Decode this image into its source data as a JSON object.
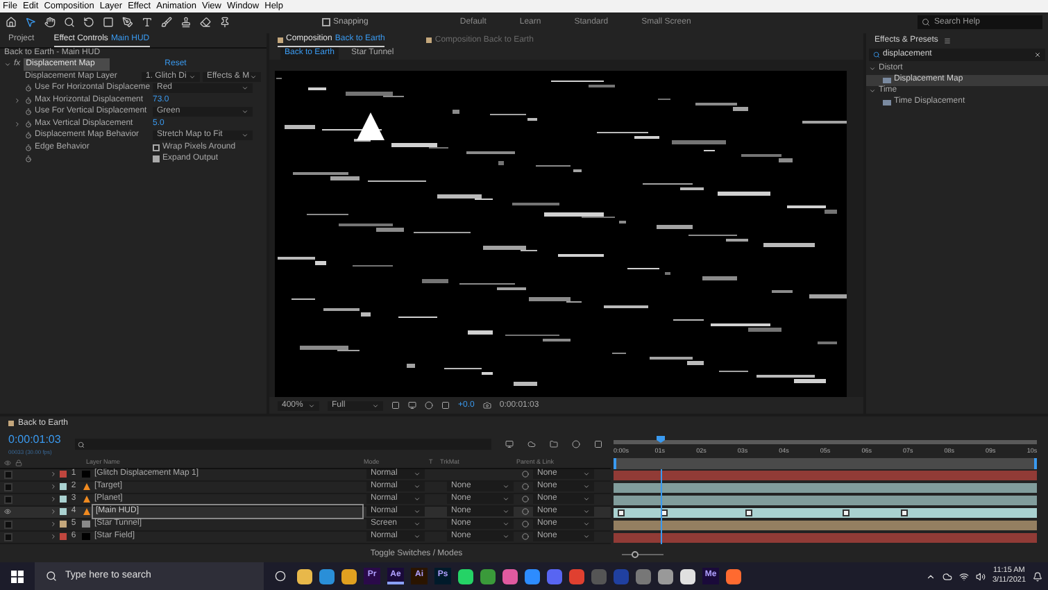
{
  "menu": [
    "File",
    "Edit",
    "Composition",
    "Layer",
    "Effect",
    "Animation",
    "View",
    "Window",
    "Help"
  ],
  "toolbar": {
    "snapping": {
      "label": "Snapping",
      "checked": false
    },
    "workspaces": [
      {
        "label": "Default",
        "selected": false
      },
      {
        "label": "Learn",
        "selected": false
      },
      {
        "label": "Standard",
        "selected": false
      },
      {
        "label": "Small Screen",
        "selected": false
      }
    ],
    "search": {
      "placeholder": "Search Help"
    }
  },
  "left_panel": {
    "tabs": [
      {
        "label": "Project",
        "selected": false
      },
      {
        "label": "Effect Controls",
        "target": "Main HUD",
        "selected": true
      }
    ],
    "breadcrumb": "Back to Earth - Main HUD",
    "effect": {
      "fx": "fx",
      "name": "Displacement Map",
      "reset": "Reset",
      "expanded": true
    },
    "rows": [
      {
        "kind": "popup2",
        "label": "Displacement Map Layer",
        "value": "1. Glitch Di",
        "value2": "Effects & M"
      },
      {
        "kind": "popup",
        "label": "Use For Horizontal Displaceme",
        "value": "Red"
      },
      {
        "kind": "number",
        "label": "Max Horizontal Displacement",
        "value": "73.0"
      },
      {
        "kind": "popup",
        "label": "Use For Vertical Displacement",
        "value": "Green"
      },
      {
        "kind": "number",
        "label": "Max Vertical Displacement",
        "value": "5.0"
      },
      {
        "kind": "popup",
        "label": "Displacement Map Behavior",
        "value": "Stretch Map to Fit"
      },
      {
        "kind": "check",
        "label": "Edge Behavior",
        "value": "Wrap Pixels Around",
        "checked": false
      },
      {
        "kind": "check",
        "value": "Expand Output",
        "checked": true
      }
    ]
  },
  "composition": {
    "tabs": [
      {
        "label": "Composition",
        "target": "Back to Earth",
        "selected": true
      },
      {
        "label": "Composition Back to Earth",
        "selected": false
      }
    ],
    "breadcrumbs": [
      {
        "label": "Back to Earth",
        "selected": true
      },
      {
        "label": "Star Tunnel",
        "selected": false
      }
    ],
    "zoom": "400%",
    "resolution": "Full",
    "exposure": "+0.0",
    "timecode": "0:00:01:03"
  },
  "effects_presets": {
    "title": "Effects & Presets",
    "search": "displacement",
    "tree": [
      {
        "label": "Distort",
        "expanded": true,
        "children": [
          {
            "label": "Displacement Map",
            "selected": true
          }
        ]
      },
      {
        "label": "Time",
        "expanded": true,
        "children": [
          {
            "label": "Time Displacement",
            "selected": false
          }
        ]
      }
    ]
  },
  "timeline": {
    "tab": "Back to Earth",
    "timecode": "0:00:01:03",
    "fps": "00033 (30.00 fps)",
    "columns": [
      "Layer Name",
      "Mode",
      "T",
      "TrkMat",
      "Parent & Link"
    ],
    "layers": [
      {
        "index": "1",
        "name": "[Glitch Displacement Map 1]",
        "color": "#c0463e",
        "kind": "solid",
        "mode": "Normal",
        "parent": "None",
        "selected": false,
        "visible": false
      },
      {
        "index": "2",
        "name": "[Target]",
        "color": "#a9d1d0",
        "kind": "vlc",
        "mode": "Normal",
        "trkmat": "None",
        "parent": "None",
        "selected": false,
        "visible": false
      },
      {
        "index": "3",
        "name": "[Planet]",
        "color": "#a9d1d0",
        "kind": "vlc",
        "mode": "Normal",
        "trkmat": "None",
        "parent": "None",
        "selected": false,
        "visible": false
      },
      {
        "index": "4",
        "name": "[Main HUD]",
        "color": "#a9d1d0",
        "kind": "vlc",
        "mode": "Normal",
        "trkmat": "None",
        "parent": "None",
        "selected": true,
        "visible": true
      },
      {
        "index": "5",
        "name": "[Star Tunnel]",
        "color": "#c4a77c",
        "kind": "comp",
        "mode": "Screen",
        "trkmat": "None",
        "parent": "None",
        "selected": false,
        "visible": false
      },
      {
        "index": "6",
        "name": "[Star Field]",
        "color": "#c0463e",
        "kind": "solid",
        "mode": "Normal",
        "trkmat": "None",
        "parent": "None",
        "selected": false,
        "visible": false
      }
    ],
    "toggle": "Toggle Switches / Modes",
    "ruler": [
      "0:00s",
      "01s",
      "02s",
      "03s",
      "04s",
      "05s",
      "06s",
      "07s",
      "08s",
      "09s",
      "10s"
    ],
    "playhead": {
      "level": 0.11
    },
    "zoom": {
      "level": 0.3
    }
  },
  "taskbar": {
    "search": {
      "placeholder": "Type here to search"
    },
    "apps": [
      {
        "color": "#e8b84a"
      },
      {
        "color": "#2a8fd8"
      },
      {
        "color": "#e0a020"
      },
      {
        "label": "Pr",
        "color": "#2a0a4a",
        "selected": false
      },
      {
        "label": "Ae",
        "color": "#1a0a3a",
        "selected": true
      },
      {
        "label": "Ai",
        "color": "#2a1400",
        "selected": false
      },
      {
        "label": "Ps",
        "color": "#001a2a",
        "selected": false
      },
      {
        "color": "#25d366"
      },
      {
        "color": "#3a9a3a"
      },
      {
        "color": "#e05aa0"
      },
      {
        "color": "#2d8cff"
      },
      {
        "color": "#5865f2"
      },
      {
        "color": "#e04030"
      },
      {
        "color": "#555555"
      },
      {
        "color": "#2040a0"
      },
      {
        "color": "#777777"
      },
      {
        "color": "#999999"
      },
      {
        "color": "#e0e0e0"
      },
      {
        "label": "Me",
        "color": "#1a0a3a",
        "selected": false
      },
      {
        "color": "#ff6a30"
      }
    ],
    "time": "11:15 AM",
    "date": "3/11/2021"
  }
}
